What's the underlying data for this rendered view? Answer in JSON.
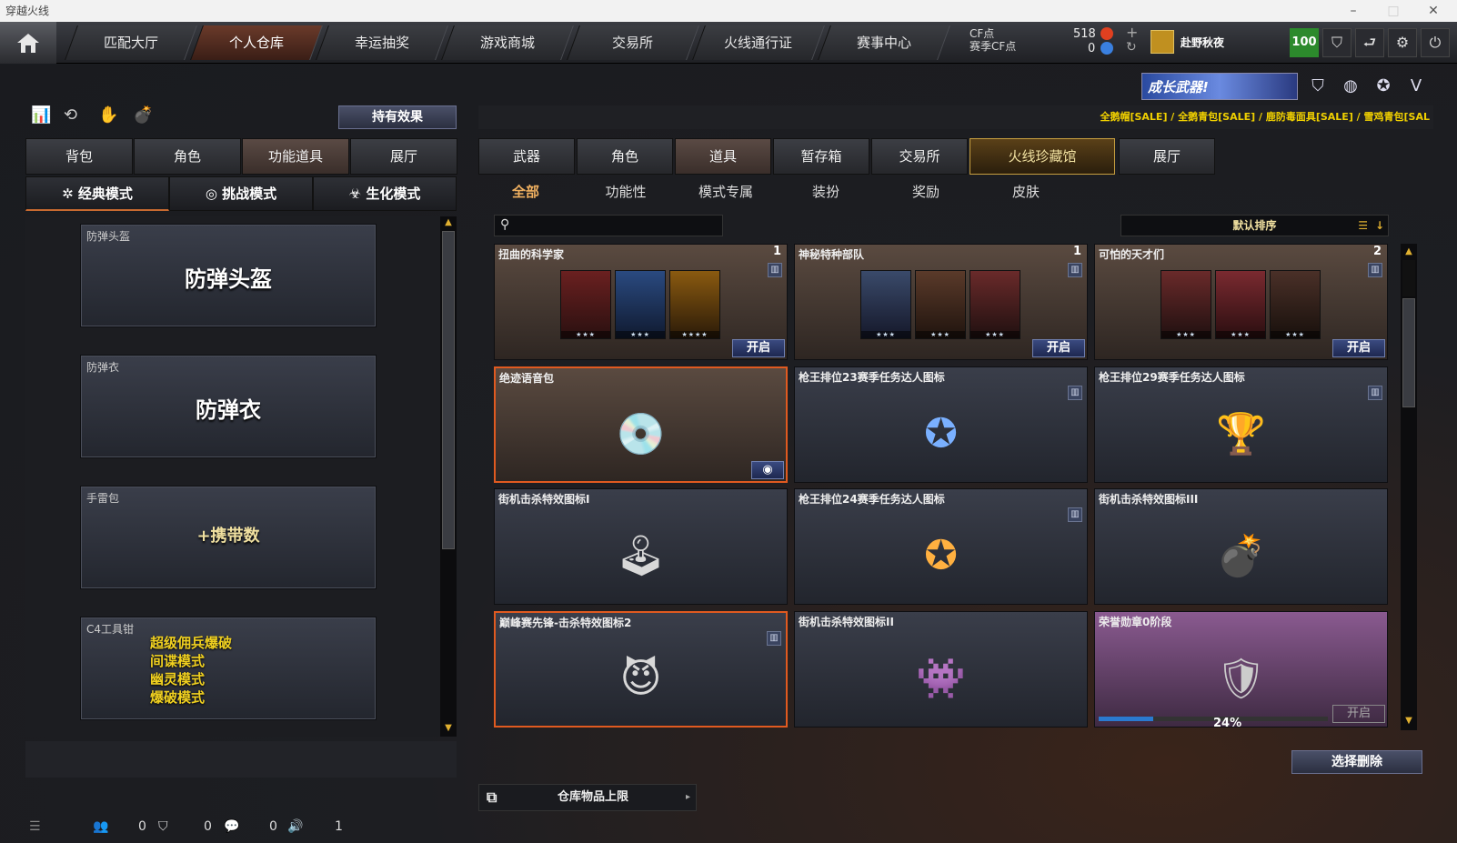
{
  "window": {
    "title": "穿越火线"
  },
  "topnav": {
    "tabs": [
      "匹配大厅",
      "个人仓库",
      "幸运抽奖",
      "游戏商城",
      "交易所",
      "火线通行证",
      "赛事中心"
    ],
    "active_tab": "个人仓库",
    "cf_label": "CF点",
    "season_cf_label": "赛季CF点",
    "cf_value": "518",
    "season_cf_value": "0",
    "username": "赴野秋夜",
    "level": "100"
  },
  "left": {
    "effect_button": "持有效果",
    "tabs": [
      "背包",
      "角色",
      "功能道具",
      "展厅"
    ],
    "active_tab": "功能道具",
    "modes": [
      "经典模式",
      "挑战模式",
      "生化模式"
    ],
    "items": [
      {
        "name": "防弹头盔",
        "big": "防弹头盔"
      },
      {
        "name": "防弹衣",
        "big": "防弹衣"
      },
      {
        "name": "手雷包",
        "big": "+携带数"
      },
      {
        "name": "C4工具钳",
        "lines": [
          "超级佣兵爆破",
          "间谍模式",
          "幽灵模式",
          "爆破模式"
        ]
      }
    ]
  },
  "right": {
    "sale_text": "全鹅帽[SALE] / 全鹅青包[SALE] / 鹿防毒面具[SALE] / 雪鸡青包[SAL",
    "promo_text": "成长武器!",
    "tabs": [
      "武器",
      "角色",
      "道具",
      "暂存箱",
      "交易所",
      "火线珍藏馆",
      "展厅"
    ],
    "active_tab": "道具",
    "subtabs": [
      "全部",
      "功能性",
      "模式专属",
      "装扮",
      "奖励",
      "皮肤"
    ],
    "active_subtab": "全部",
    "search_placeholder": "",
    "sort_label": "默认排序",
    "open_label": "开启",
    "cards": [
      {
        "name": "扭曲的科学家",
        "count": "1",
        "open": true
      },
      {
        "name": "神秘特种部队",
        "count": "1",
        "open": true
      },
      {
        "name": "可怕的天才们",
        "count": "2",
        "open": true
      },
      {
        "name": "绝迹语音包"
      },
      {
        "name": "枪王排位23赛季任务达人图标"
      },
      {
        "name": "枪王排位29赛季任务达人图标"
      },
      {
        "name": "街机击杀特效图标I"
      },
      {
        "name": "枪王排位24赛季任务达人图标"
      },
      {
        "name": "街机击杀特效图标III"
      },
      {
        "name": "巅峰赛先锋-击杀特效图标2"
      },
      {
        "name": "街机击杀特效图标II"
      },
      {
        "name": "荣誉勋章0阶段",
        "progress": "24%",
        "progress_value": 0.24
      }
    ],
    "delete_button": "选择删除",
    "storage_label": "仓库物品上限"
  },
  "status": {
    "friends": "0",
    "clan": "0",
    "chat": "0",
    "volume": "1"
  }
}
